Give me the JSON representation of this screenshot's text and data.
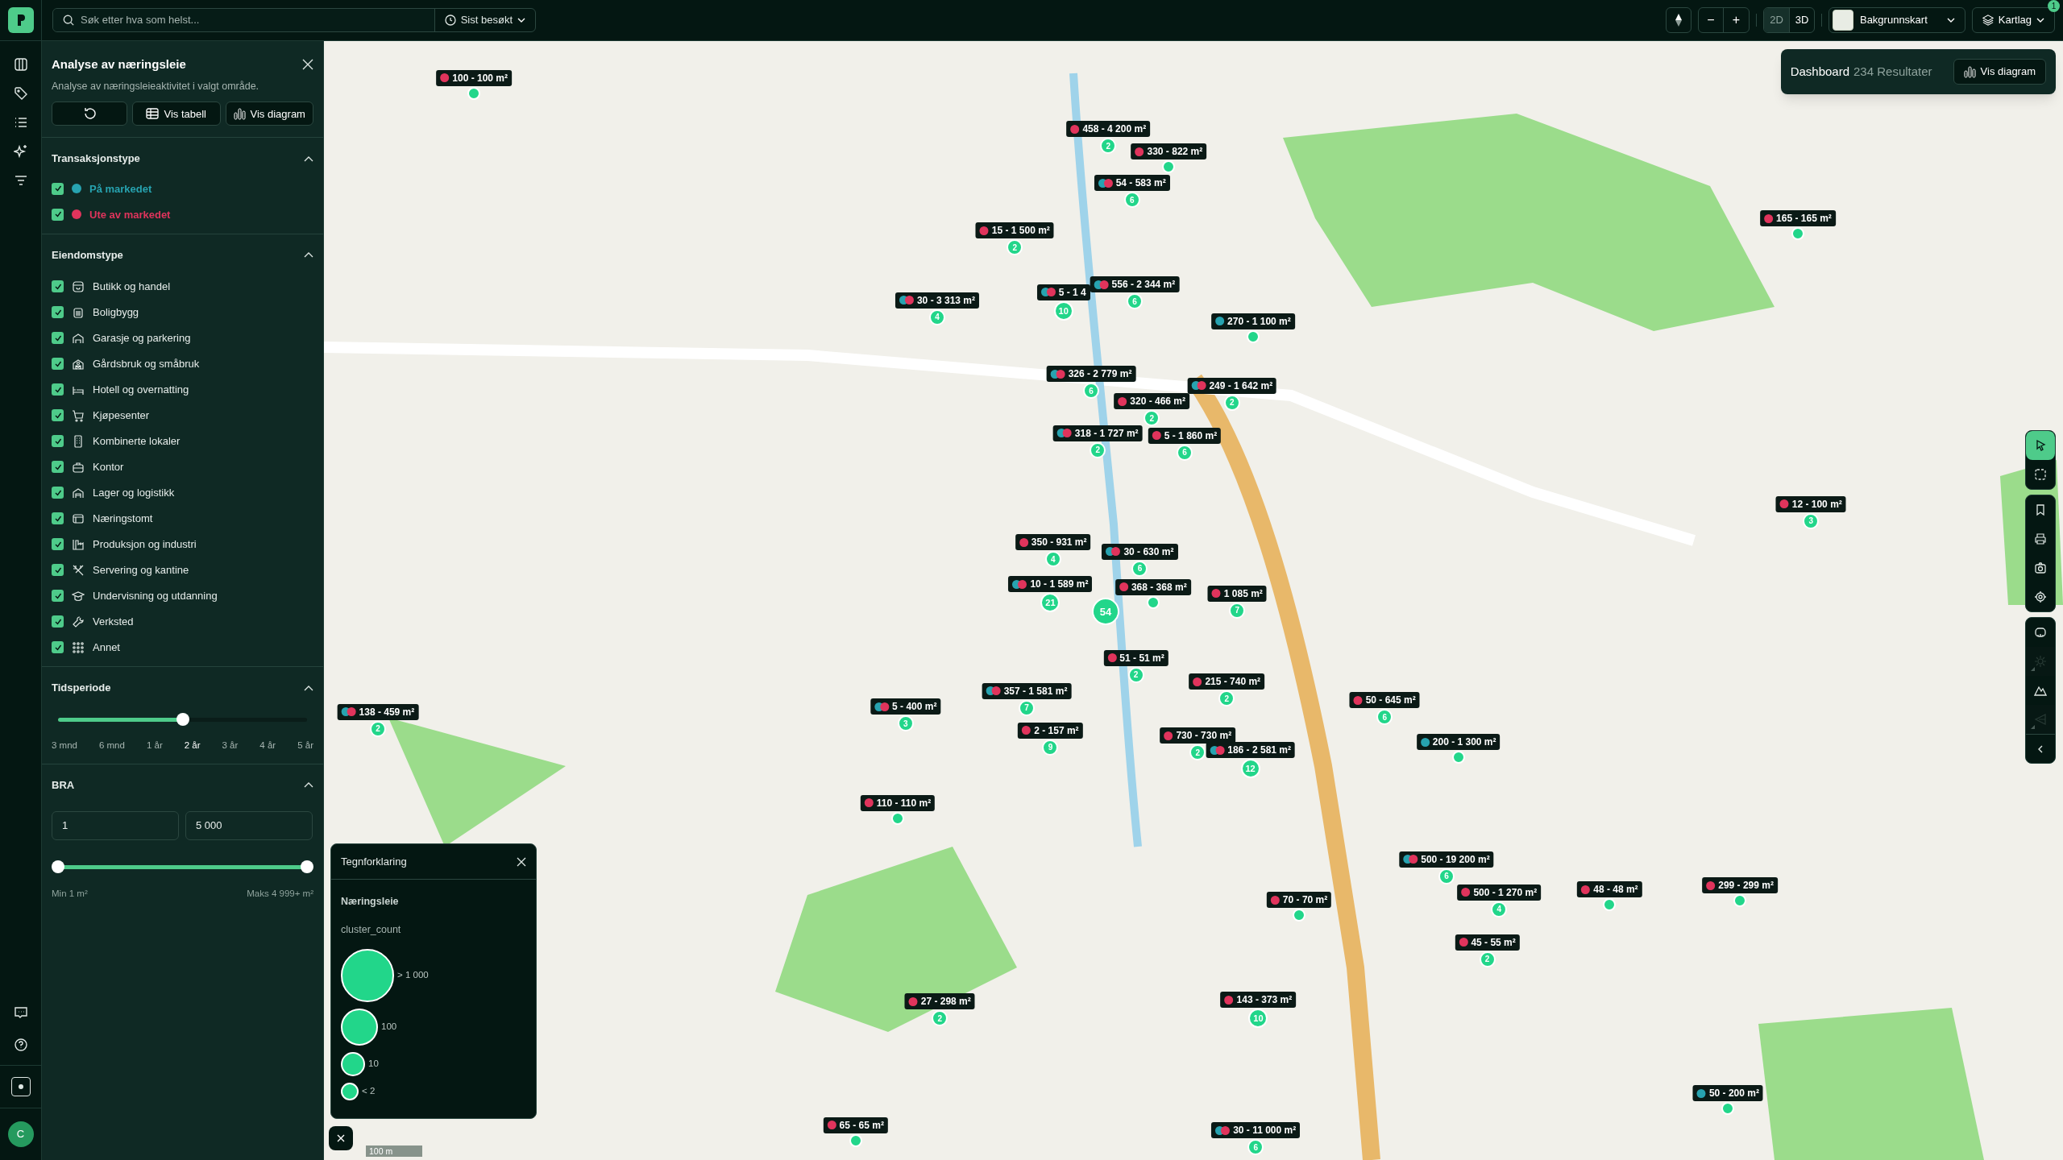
{
  "search": {
    "placeholder": "Søk etter hva som helst...",
    "recent": "Sist besøkt"
  },
  "map_controls": {
    "zoom_out": "−",
    "zoom_in": "+",
    "views": [
      {
        "label": "2D",
        "selected": true
      },
      {
        "label": "3D",
        "selected": false
      }
    ],
    "basemap": "Bakgrunnskart",
    "layers": "Kartlag",
    "layers_badge": "1"
  },
  "panel": {
    "title": "Analyse av næringsleie",
    "subtitle": "Analyse av næringsleieaktivitet i valgt område.",
    "buttons": [
      "Vis tabell",
      "Vis diagram"
    ],
    "transaction_section": {
      "title": "Transaksjonstype",
      "expanded": true,
      "items": [
        {
          "label": "På markedet",
          "checked": true,
          "color": "#27a3b0"
        },
        {
          "label": "Ute av markedet",
          "checked": true,
          "color": "#e0345c"
        }
      ]
    },
    "property_section": {
      "title": "Eiendomstype",
      "expanded": true,
      "items": [
        {
          "label": "Butikk og handel",
          "checked": true
        },
        {
          "label": "Boligbygg",
          "checked": true
        },
        {
          "label": "Garasje og parkering",
          "checked": true
        },
        {
          "label": "Gårdsbruk og småbruk",
          "checked": true
        },
        {
          "label": "Hotell og overnatting",
          "checked": true
        },
        {
          "label": "Kjøpesenter",
          "checked": true
        },
        {
          "label": "Kombinerte lokaler",
          "checked": true
        },
        {
          "label": "Kontor",
          "checked": true
        },
        {
          "label": "Lager og logistikk",
          "checked": true
        },
        {
          "label": "Næringstomt",
          "checked": true
        },
        {
          "label": "Produksjon og industri",
          "checked": true
        },
        {
          "label": "Servering og kantine",
          "checked": true
        },
        {
          "label": "Undervisning og utdanning",
          "checked": true
        },
        {
          "label": "Verksted",
          "checked": true
        },
        {
          "label": "Annet",
          "checked": true
        }
      ]
    },
    "period_section": {
      "title": "Tidsperiode",
      "expanded": true,
      "level": 0.5,
      "ticks": [
        {
          "label": "3 mnd",
          "selected": false
        },
        {
          "label": "6 mnd",
          "selected": false
        },
        {
          "label": "1 år",
          "selected": false
        },
        {
          "label": "2 år",
          "selected": true
        },
        {
          "label": "3 år",
          "selected": false
        },
        {
          "label": "4 år",
          "selected": false
        },
        {
          "label": "5 år",
          "selected": false
        }
      ]
    },
    "area_section": {
      "title": "BRA",
      "expanded": true,
      "min_value": "1",
      "max_value": "5 000",
      "handles": [
        {
          "level": 0
        },
        {
          "level": 1
        }
      ],
      "min_label": "Min 1 m²",
      "max_label": "Maks 4 999+ m²"
    }
  },
  "user": {
    "initial": "C"
  },
  "dashboard": {
    "title": "Dashboard",
    "results": "234 Resultater",
    "button": "Vis diagram"
  },
  "tools": [
    [
      {
        "selected": true,
        "disabled": false
      },
      {
        "selected": false,
        "disabled": false
      }
    ],
    [
      {
        "selected": false,
        "disabled": false
      },
      {
        "selected": false,
        "disabled": false
      },
      {
        "selected": false,
        "disabled": false
      },
      {
        "selected": false,
        "disabled": false
      }
    ],
    [
      {
        "selected": false,
        "disabled": false
      },
      {
        "selected": false,
        "disabled": true
      },
      {
        "selected": false,
        "disabled": false
      },
      {
        "selected": false,
        "disabled": true
      }
    ]
  ],
  "markers": [
    {
      "label": "100 - 100 m²",
      "dots": [
        {
          "color": "#e0345c"
        }
      ]
    },
    {
      "label": "458 - 4 200 m²",
      "dots": [
        {
          "color": "#e0345c"
        }
      ],
      "count": "2"
    },
    {
      "label": "330 - 822 m²",
      "dots": [
        {
          "color": "#e0345c"
        }
      ]
    },
    {
      "label": "54 - 583 m²",
      "dots": [
        {
          "color": "#27a3b0"
        },
        {
          "color": "#e0345c"
        }
      ],
      "count": "6"
    },
    {
      "label": "15 - 1 500 m²",
      "dots": [
        {
          "color": "#e0345c"
        }
      ],
      "count": "2"
    },
    {
      "label": "165 - 165 m²",
      "dots": [
        {
          "color": "#e0345c"
        }
      ]
    },
    {
      "label": "30 - 3 313 m²",
      "dots": [
        {
          "color": "#27a3b0"
        },
        {
          "color": "#e0345c"
        }
      ],
      "count": "4"
    },
    {
      "label": "5 - 1 4",
      "dots": [
        {
          "color": "#27a3b0"
        },
        {
          "color": "#e0345c"
        }
      ],
      "count": "10"
    },
    {
      "label": "556 - 2 344 m²",
      "dots": [
        {
          "color": "#27a3b0"
        },
        {
          "color": "#e0345c"
        }
      ],
      "count": "6"
    },
    {
      "label": "270 - 1 100 m²",
      "dots": [
        {
          "color": "#27a3b0"
        }
      ]
    },
    {
      "label": "326 - 2 779 m²",
      "dots": [
        {
          "color": "#27a3b0"
        },
        {
          "color": "#e0345c"
        }
      ],
      "count": "6"
    },
    {
      "label": "249 - 1 642 m²",
      "dots": [
        {
          "color": "#27a3b0"
        },
        {
          "color": "#e0345c"
        }
      ],
      "count": "2"
    },
    {
      "label": "320 - 466 m²",
      "dots": [
        {
          "color": "#e0345c"
        }
      ],
      "count": "2"
    },
    {
      "label": "318 - 1 727 m²",
      "dots": [
        {
          "color": "#27a3b0"
        },
        {
          "color": "#e0345c"
        }
      ],
      "count": "2"
    },
    {
      "label": "5 - 1 860 m²",
      "dots": [
        {
          "color": "#e0345c"
        }
      ],
      "count": "6"
    },
    {
      "label": "12 - 100 m²",
      "dots": [
        {
          "color": "#e0345c"
        }
      ],
      "count": "3"
    },
    {
      "label": "350 - 931 m²",
      "dots": [
        {
          "color": "#e0345c"
        }
      ],
      "count": "4"
    },
    {
      "label": "30 - 630 m²",
      "dots": [
        {
          "color": "#27a3b0"
        },
        {
          "color": "#e0345c"
        }
      ],
      "count": "6"
    },
    {
      "label": "10 - 1 589 m²",
      "dots": [
        {
          "color": "#27a3b0"
        },
        {
          "color": "#e0345c"
        }
      ],
      "count": "21"
    },
    {
      "count": "54"
    },
    {
      "label": "368 - 368 m²",
      "dots": [
        {
          "color": "#e0345c"
        }
      ]
    },
    {
      "label": "1 085 m²",
      "dots": [
        {
          "color": "#e0345c"
        }
      ],
      "count": "7"
    },
    {
      "label": "51 - 51 m²",
      "dots": [
        {
          "color": "#e0345c"
        }
      ],
      "count": "2"
    },
    {
      "label": "215 - 740 m²",
      "dots": [
        {
          "color": "#e0345c"
        }
      ],
      "count": "2"
    },
    {
      "label": "138 - 459 m²",
      "dots": [
        {
          "color": "#27a3b0"
        },
        {
          "color": "#e0345c"
        }
      ],
      "count": "2"
    },
    {
      "label": "5 - 400 m²",
      "dots": [
        {
          "color": "#27a3b0"
        },
        {
          "color": "#e0345c"
        }
      ],
      "count": "3"
    },
    {
      "label": "357 - 1 581 m²",
      "dots": [
        {
          "color": "#27a3b0"
        },
        {
          "color": "#e0345c"
        }
      ],
      "count": "7"
    },
    {
      "label": "50 - 645 m²",
      "dots": [
        {
          "color": "#e0345c"
        }
      ],
      "count": "6"
    },
    {
      "label": "2 - 157 m²",
      "dots": [
        {
          "color": "#e0345c"
        }
      ],
      "count": "9"
    },
    {
      "label": "730 - 730 m²",
      "dots": [
        {
          "color": "#e0345c"
        }
      ],
      "count": "2"
    },
    {
      "label": "186 - 2 581 m²",
      "dots": [
        {
          "color": "#27a3b0"
        },
        {
          "color": "#e0345c"
        }
      ],
      "count": "12"
    },
    {
      "label": "200 - 1 300 m²",
      "dots": [
        {
          "color": "#27a3b0"
        }
      ]
    },
    {
      "label": "110 - 110 m²",
      "dots": [
        {
          "color": "#e0345c"
        }
      ]
    },
    {
      "label": "500 - 19 200 m²",
      "dots": [
        {
          "color": "#27a3b0"
        },
        {
          "color": "#e0345c"
        }
      ],
      "count": "6"
    },
    {
      "label": "70 - 70 m²",
      "dots": [
        {
          "color": "#e0345c"
        }
      ]
    },
    {
      "label": "500 - 1 270 m²",
      "dots": [
        {
          "color": "#e0345c"
        }
      ],
      "count": "4"
    },
    {
      "label": "48 - 48 m²",
      "dots": [
        {
          "color": "#e0345c"
        }
      ]
    },
    {
      "label": "299 - 299 m²",
      "dots": [
        {
          "color": "#e0345c"
        }
      ]
    },
    {
      "label": "45 - 55 m²",
      "dots": [
        {
          "color": "#e0345c"
        }
      ],
      "count": "2"
    },
    {
      "label": "27 - 298 m²",
      "dots": [
        {
          "color": "#e0345c"
        }
      ],
      "count": "2"
    },
    {
      "label": "143 - 373 m²",
      "dots": [
        {
          "color": "#e0345c"
        }
      ],
      "count": "10"
    },
    {
      "label": "50 - 200 m²",
      "dots": [
        {
          "color": "#27a3b0"
        }
      ]
    },
    {
      "label": "65 - 65 m²",
      "dots": [
        {
          "color": "#e0345c"
        }
      ]
    },
    {
      "label": "30 - 11 000 m²",
      "dots": [
        {
          "color": "#27a3b0"
        },
        {
          "color": "#e0345c"
        }
      ],
      "count": "6"
    }
  ],
  "legend": {
    "title": "Tegnforklaring",
    "layer": "Næringsleie",
    "field": "cluster_count",
    "entries": [
      "> 1 000",
      "100",
      "10",
      "< 2"
    ]
  },
  "scale": "100 m"
}
